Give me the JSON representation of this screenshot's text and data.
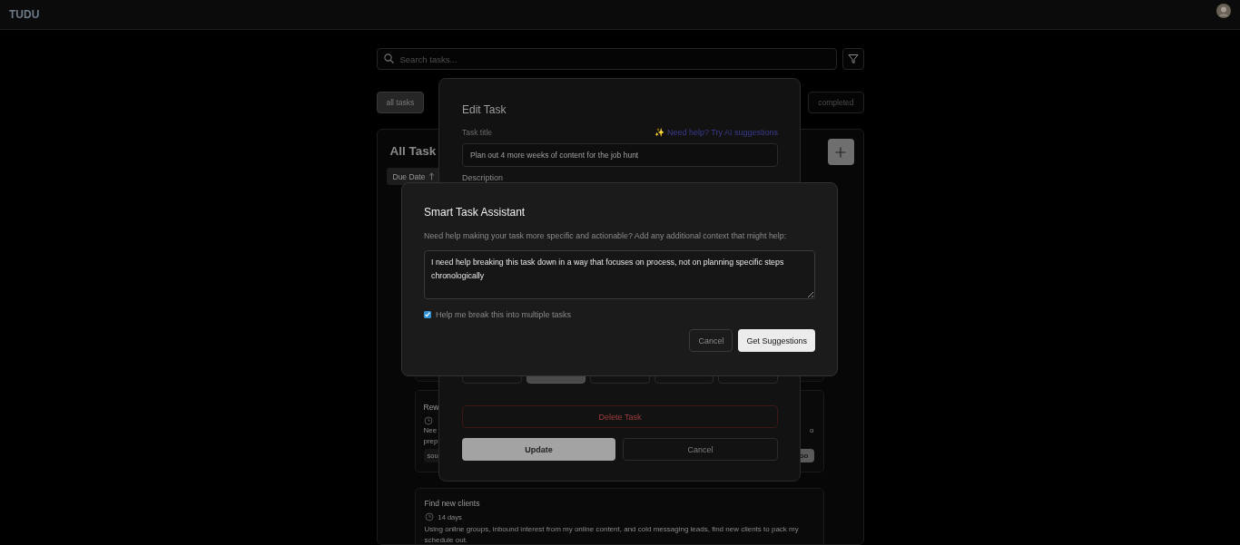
{
  "app": {
    "logo": "TUDU"
  },
  "search": {
    "placeholder": "Search tasks..."
  },
  "filter_tabs": [
    {
      "label": "all tasks",
      "selected": true
    },
    {
      "label": "completed",
      "selected": false
    }
  ],
  "task_list": {
    "title": "All Task",
    "sort": "Due Date",
    "tasks": [
      {
        "kind": "hidden"
      },
      {
        "kind": "partial",
        "title": "Rew",
        "description_lines": [
          "Nee",
          "prep"
        ],
        "right_text": "o",
        "tag": "sou",
        "badge": "oo"
      },
      {
        "kind": "full",
        "title": "Find new clients",
        "due": "14 days",
        "description": "Using online groups, inbound interest from my online content, and cold messaging leads, find new clients to pack my schedule out."
      }
    ]
  },
  "edit_task": {
    "title": "Edit Task",
    "title_label": "Task title",
    "ai_link": "✨ Need help? Try AI suggestions",
    "title_value": "Plan out 4 more weeks of content for the job hunt",
    "description_label": "Description",
    "priority_options": [
      {
        "selected": false
      },
      {
        "selected": true
      },
      {
        "selected": false
      },
      {
        "selected": false
      },
      {
        "selected": false
      }
    ],
    "delete_button": "Delete Task",
    "update_button": "Update",
    "cancel_button": "Cancel"
  },
  "assistant": {
    "title": "Smart Task Assistant",
    "prompt": "Need help making your task more specific and actionable? Add any additional context that might help:",
    "context": "I need help breaking this task down in a way that focuses on process, not on planning specific steps chronologically",
    "split_tasks": {
      "label": "Help me break this into multiple tasks",
      "checked": true
    },
    "buttons": [
      {
        "label": "Cancel",
        "kind": "secondary"
      },
      {
        "label": "Get Suggestions",
        "kind": "primary"
      }
    ]
  }
}
